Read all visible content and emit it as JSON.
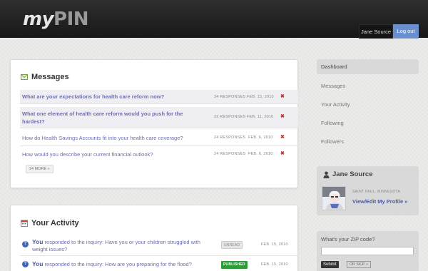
{
  "header": {
    "logo_my": "my",
    "logo_pin": "PIN",
    "user_name": "Jane Source",
    "logout_label": "Log out"
  },
  "messages": {
    "title": "Messages",
    "rows": [
      {
        "question": "What are your expectations for health care reform now?",
        "responses": "34 RESPONSES",
        "date": "FEB. 15, 2010",
        "unread": true
      },
      {
        "question": "What one element of health care reform would you push for the hardest?",
        "responses": "22 RESPONSES",
        "date": "FEB. 11, 2010",
        "unread": true
      },
      {
        "question": "How do Health Savings Accounts fit into your health care coverage?",
        "responses": "24 RESPONSES",
        "date": "FEB. 6, 2010",
        "unread": false
      },
      {
        "question": "How would you describe your current financial outlook?",
        "responses": "24 RESPONSES",
        "date": "FEB. 6, 2010",
        "unread": false
      }
    ],
    "delete_glyph": "✖",
    "more_label": "24 MORE »"
  },
  "activity": {
    "title": "Your Activity",
    "rows": [
      {
        "you": "You",
        "text": " responded to the inquiry: Have you or your children struggled with weight issues?",
        "status": "UNREAD",
        "date": "FEB. 15, 2010"
      },
      {
        "you": "You",
        "text": " responded to the inquiry: How are you preparing for the flood?",
        "status": "PUBLISHED",
        "date": "FEB. 15, 2010"
      }
    ]
  },
  "sidebar": {
    "nav": [
      {
        "label": "Dashboard",
        "active": true
      },
      {
        "label": "Messages",
        "active": false
      },
      {
        "label": "Your Activity",
        "active": false
      },
      {
        "label": "Following",
        "active": false
      },
      {
        "label": "Followers",
        "active": false
      }
    ],
    "profile": {
      "name": "Jane Source",
      "location": "SAINT PAUL, MINNESOTA",
      "edit_link": "View/Edit My Profile »"
    },
    "zip": {
      "label": "What's your ZIP code?",
      "value": "",
      "submit_label": "Submit",
      "skip_label": "OR SKIP »"
    }
  },
  "colors": {
    "accent_blue": "#6a8fd1",
    "link_purple": "#6d6eb0",
    "delete_red": "#c23a2b",
    "published_green": "#2f9a3a"
  }
}
